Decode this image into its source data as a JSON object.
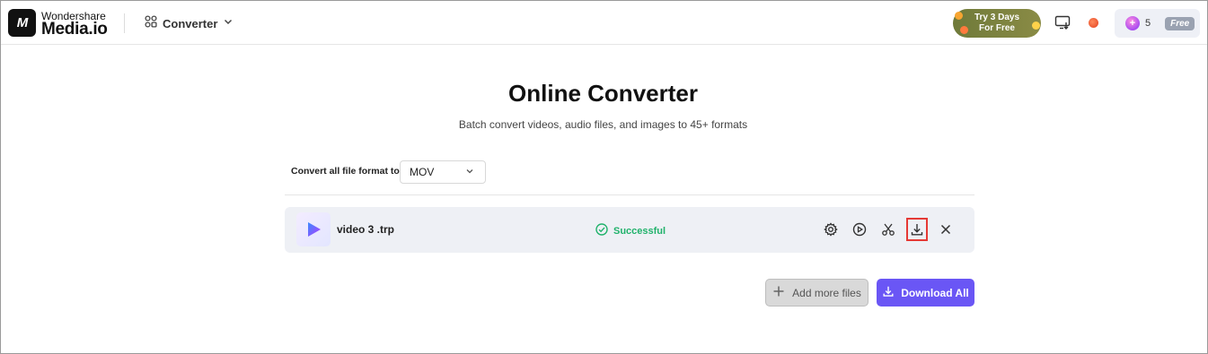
{
  "brand": {
    "badge": "M",
    "name_top": "Wondershare",
    "name_bottom": "Media.io"
  },
  "nav": {
    "converter_label": "Converter",
    "icon": "grid-icon"
  },
  "header": {
    "trial_line1": "Try 3 Days",
    "trial_line2": "For Free",
    "credits_count": "5",
    "plan_badge": "Free"
  },
  "main": {
    "title": "Online Converter",
    "subtitle": "Batch convert videos, audio files, and images to 45+ formats",
    "format_label": "Convert all file format to:",
    "format_value": "MOV"
  },
  "files": [
    {
      "name": "video 3 .trp",
      "status": "Successful"
    }
  ],
  "actions": {
    "add_more_label": "Add more files",
    "download_all_label": "Download All"
  },
  "colors": {
    "accent": "#6a56f5",
    "success": "#20b26b",
    "highlight": "#e53935"
  }
}
